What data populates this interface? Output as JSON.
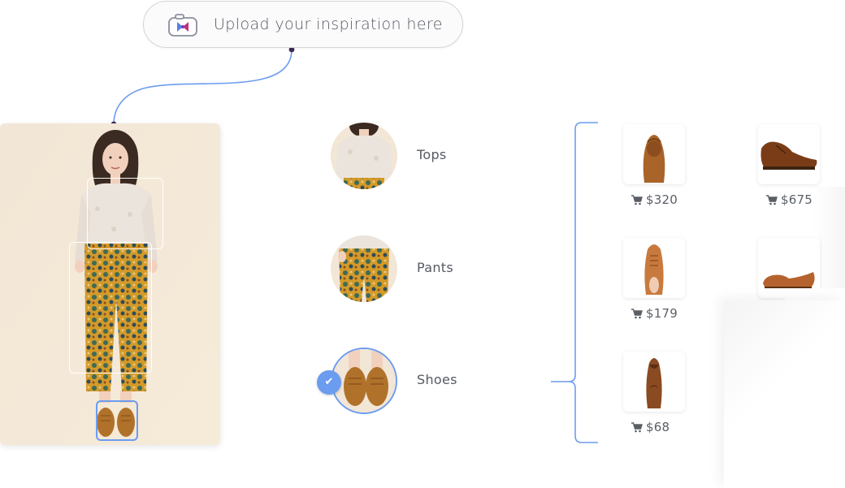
{
  "upload": {
    "label": "Upload your inspiration here",
    "icon": "camera-icon"
  },
  "colors": {
    "accent": "#6c9cf0",
    "connector_dot": "#3b2a5a"
  },
  "categories": [
    {
      "label": "Tops",
      "selected": false
    },
    {
      "label": "Pants",
      "selected": false
    },
    {
      "label": "Shoes",
      "selected": true
    }
  ],
  "products": [
    {
      "price": "$320"
    },
    {
      "price": "$675"
    },
    {
      "price": "$179"
    },
    {
      "price": ""
    },
    {
      "price": "$68"
    }
  ]
}
